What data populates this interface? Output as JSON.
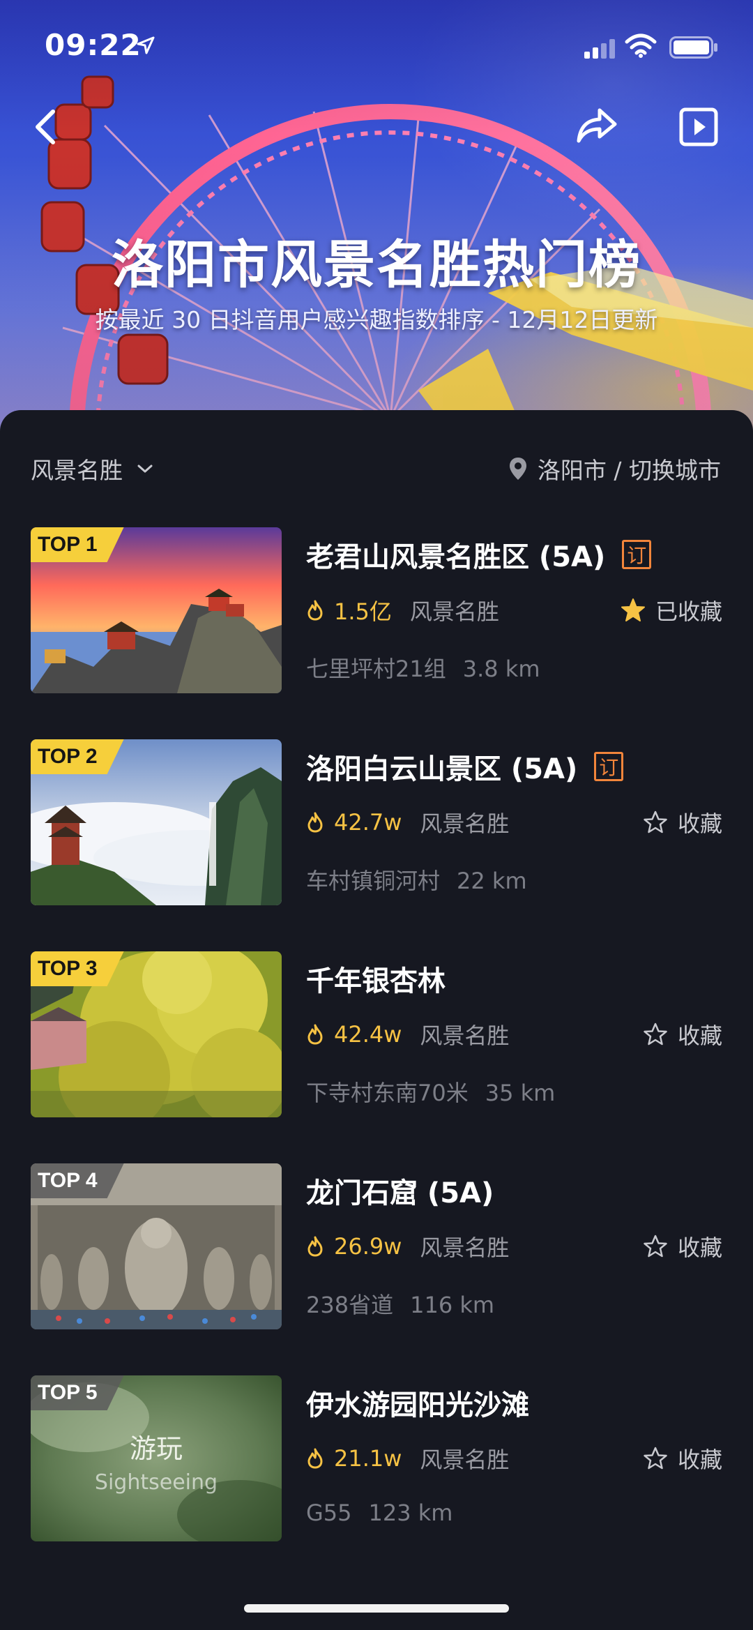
{
  "status_bar": {
    "time": "09:22"
  },
  "hero": {
    "title": "洛阳市风景名胜热门榜",
    "subtitle": "按最近 30 日抖音用户感兴趣指数排序 - 12月12日更新"
  },
  "filter": {
    "category": "风景名胜",
    "city": "洛阳市 / 切换城市"
  },
  "items": [
    {
      "rank": "TOP 1",
      "name": "老君山风景名胜区 (5A)",
      "tag": "订",
      "heat": "1.5亿",
      "category": "风景名胜",
      "fav": "已收藏",
      "favorited": true,
      "addr": "七里坪村21组",
      "dist": "3.8 km"
    },
    {
      "rank": "TOP 2",
      "name": "洛阳白云山景区 (5A)",
      "tag": "订",
      "heat": "42.7w",
      "category": "风景名胜",
      "fav": "收藏",
      "favorited": false,
      "addr": "车村镇铜河村",
      "dist": "22 km"
    },
    {
      "rank": "TOP 3",
      "name": "千年银杏林",
      "heat": "42.4w",
      "category": "风景名胜",
      "fav": "收藏",
      "favorited": false,
      "addr": "下寺村东南70米",
      "dist": "35 km"
    },
    {
      "rank": "TOP 4",
      "name": "龙门石窟 (5A)",
      "heat": "26.9w",
      "category": "风景名胜",
      "fav": "收藏",
      "favorited": false,
      "addr": "238省道",
      "dist": "116 km"
    },
    {
      "rank": "TOP 5",
      "name": "伊水游园阳光沙滩",
      "heat": "21.1w",
      "category": "风景名胜",
      "fav": "收藏",
      "favorited": false,
      "addr": "G55",
      "dist": "123 km",
      "thumb_title": "游玩",
      "thumb_sub": "Sightseeing"
    }
  ],
  "colors": {
    "accent_yellow": "#f6c244",
    "tag_orange": "#f2853b",
    "background": "#161821"
  }
}
